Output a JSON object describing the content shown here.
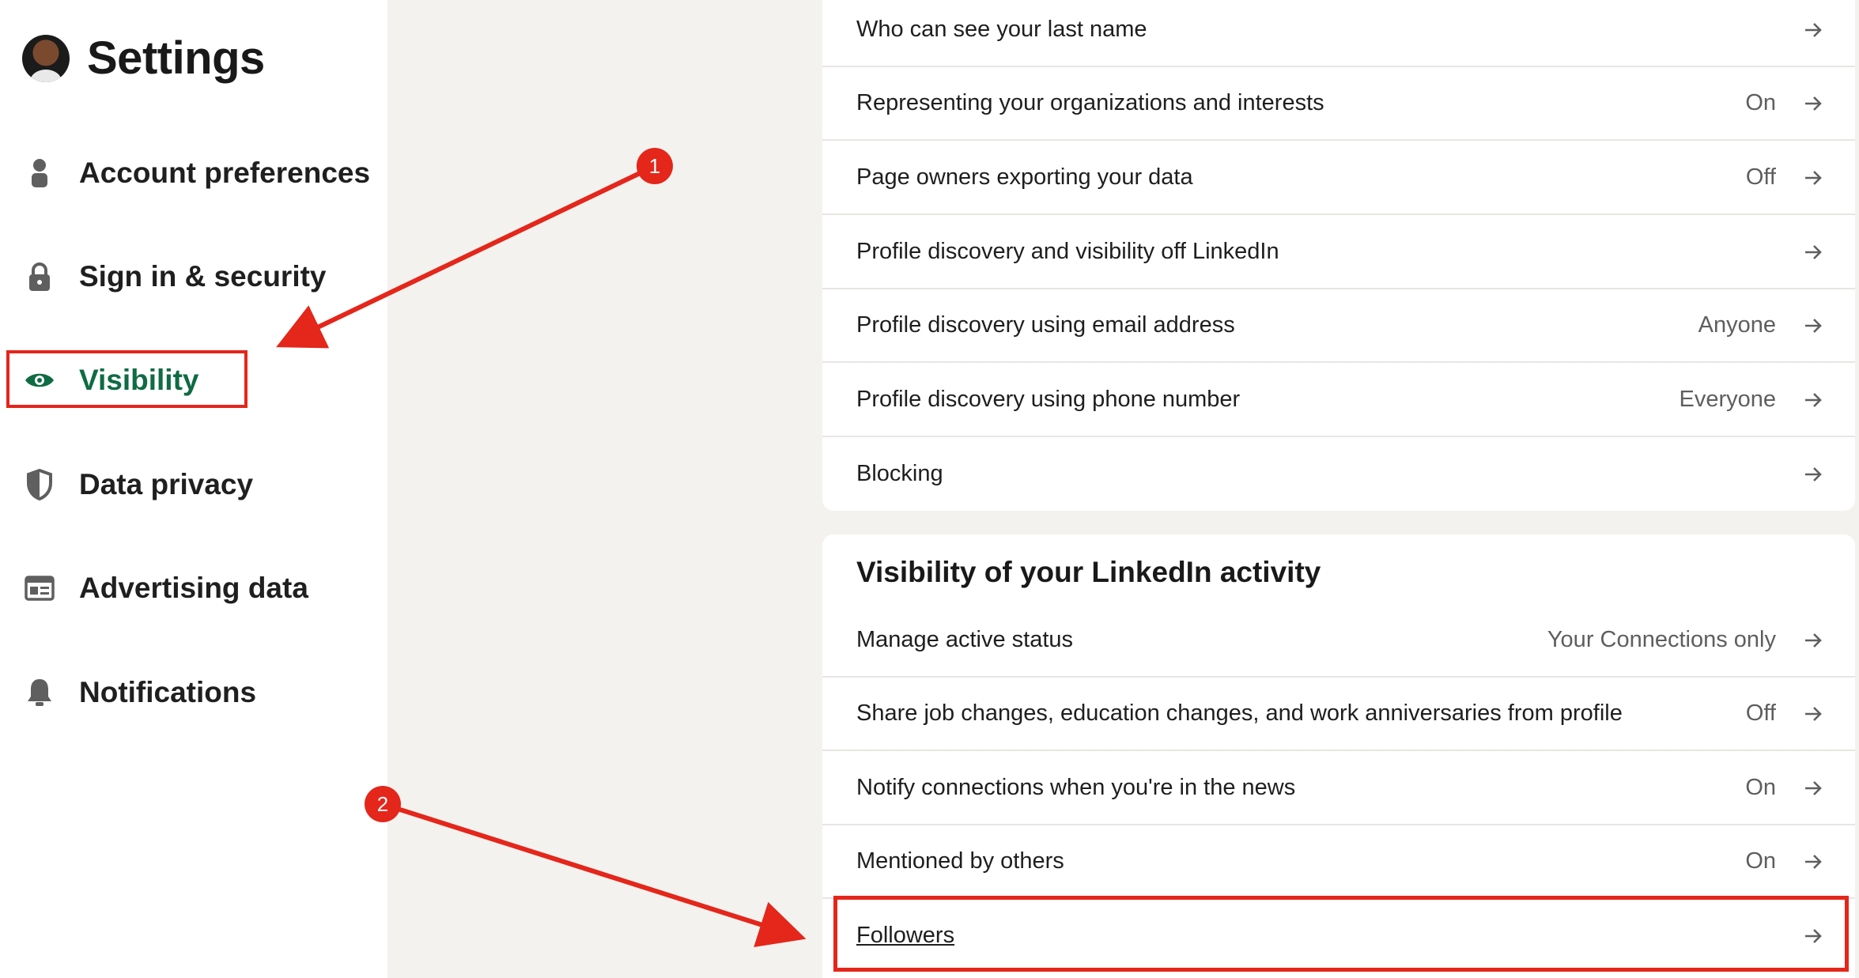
{
  "sidebar": {
    "title": "Settings",
    "items": [
      {
        "label": "Account preferences",
        "icon": "person-icon"
      },
      {
        "label": "Sign in & security",
        "icon": "lock-icon"
      },
      {
        "label": "Visibility",
        "icon": "eye-icon",
        "active": true
      },
      {
        "label": "Data privacy",
        "icon": "shield-icon"
      },
      {
        "label": "Advertising data",
        "icon": "ad-card-icon"
      },
      {
        "label": "Notifications",
        "icon": "bell-icon"
      }
    ]
  },
  "profile_visibility_rows": [
    {
      "label": "Who can see your last name",
      "value": ""
    },
    {
      "label": "Representing your organizations and interests",
      "value": "On"
    },
    {
      "label": "Page owners exporting your data",
      "value": "Off"
    },
    {
      "label": "Profile discovery and visibility off LinkedIn",
      "value": ""
    },
    {
      "label": "Profile discovery using email address",
      "value": "Anyone"
    },
    {
      "label": "Profile discovery using phone number",
      "value": "Everyone"
    },
    {
      "label": "Blocking",
      "value": ""
    }
  ],
  "activity_section": {
    "title": "Visibility of your LinkedIn activity",
    "rows": [
      {
        "label": "Manage active status",
        "value": "Your Connections only"
      },
      {
        "label": "Share job changes, education changes, and work anniversaries from profile",
        "value": "Off"
      },
      {
        "label": "Notify connections when you're in the news",
        "value": "On"
      },
      {
        "label": "Mentioned by others",
        "value": "On"
      },
      {
        "label": "Followers",
        "value": ""
      }
    ]
  },
  "annotations": {
    "badge1": "1",
    "badge2": "2",
    "color": "#e4261b"
  },
  "colors": {
    "accent_green": "#0f6b43",
    "page_background": "#f4f2ee"
  }
}
